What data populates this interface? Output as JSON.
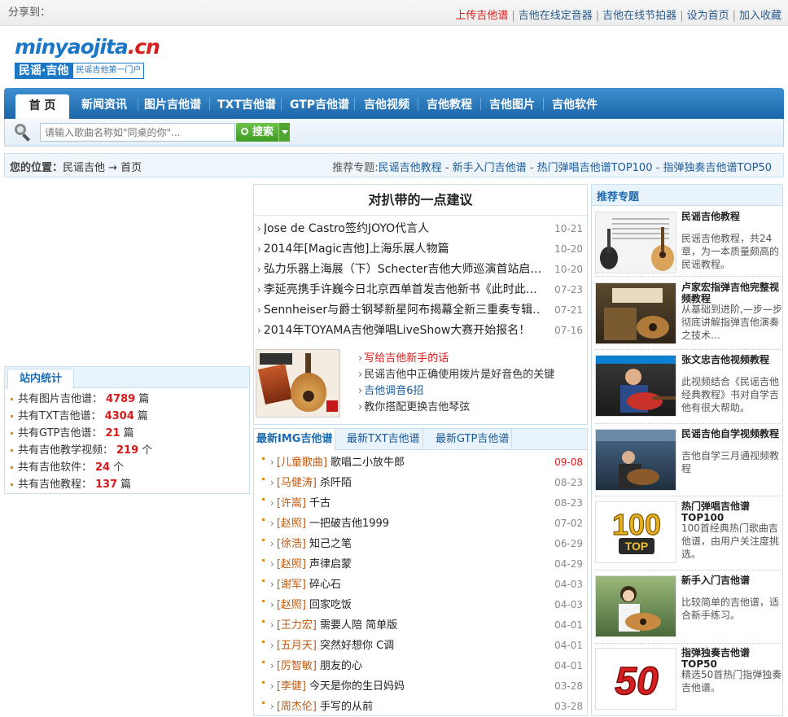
{
  "topbar": {
    "share_label": "分享到：",
    "links": [
      {
        "label": "上传吉他谱",
        "hot": true
      },
      {
        "label": "吉他在线定音器",
        "hot": false
      },
      {
        "label": "吉他在线节拍器",
        "hot": false
      },
      {
        "label": "设为首页",
        "hot": false
      },
      {
        "label": "加入收藏",
        "hot": false
      }
    ]
  },
  "logo": {
    "word_main": "minyaojita",
    "word_dot": ".cn",
    "cn_name": "民谣·吉他",
    "tagline": "民谣吉他第一门户"
  },
  "nav": {
    "items": [
      "首 页",
      "新闻资讯",
      "图片吉他谱",
      "TXT吉他谱",
      "GTP吉他谱",
      "吉他视频",
      "吉他教程",
      "吉他图片",
      "吉他软件"
    ]
  },
  "search": {
    "placeholder": "请输入歌曲名称如\"同桌的你\"...",
    "button_label": "搜索"
  },
  "breadcrumb": {
    "label": "您的位置：",
    "path": "民谣吉他 → 首页",
    "recommend_label": "推荐专题:",
    "recommend_links": [
      "民谣吉他教程",
      "新手入门吉他谱",
      "热门弹唱吉他谱TOP100",
      "指弹独奏吉他谱TOP50"
    ],
    "sep": " - "
  },
  "stats": {
    "title": "站内统计",
    "items": [
      {
        "prefix": "共有图片吉他谱：",
        "num": "4789",
        "unit": "篇"
      },
      {
        "prefix": "共有TXT吉他谱：",
        "num": "4304",
        "unit": "篇"
      },
      {
        "prefix": "共有GTP吉他谱：",
        "num": "21",
        "unit": "篇"
      },
      {
        "prefix": "共有吉他教学视频：",
        "num": "219",
        "unit": "个"
      },
      {
        "prefix": "共有吉他软件：",
        "num": "24",
        "unit": "个"
      },
      {
        "prefix": "共有吉他教程：",
        "num": "137",
        "unit": "篇"
      }
    ]
  },
  "news": {
    "title": "对扒带的一点建议",
    "items": [
      {
        "title": "Jose de Castro签约JOYO代言人",
        "date": "10-21"
      },
      {
        "title": "2014年[Magic吉他]上海乐展人物篇",
        "date": "10-20"
      },
      {
        "title": "弘力乐器上海展（下）Schecter吉他大师巡演首站启…",
        "date": "10-20"
      },
      {
        "title": "李延亮携手许巍今日北京西单首发吉他新书《此时此…",
        "date": "07-23"
      },
      {
        "title": "Sennheiser与爵士钢琴新星阿布揭幕全新三重奏专辑…",
        "date": "07-21"
      },
      {
        "title": "2014年TOYAMA吉他弹唱LiveShow大赛开始报名！",
        "date": "07-16"
      }
    ]
  },
  "promo": {
    "links": [
      {
        "label": "写给吉他新手的话",
        "style": "red"
      },
      {
        "label": "民谣吉他中正确使用拨片是好音色的关键",
        "style": "plain"
      },
      {
        "label": "吉他调音6招",
        "style": "blue"
      },
      {
        "label": "教你搭配更换吉他琴弦",
        "style": "plain"
      }
    ]
  },
  "tabs": {
    "labels": [
      "最新IMG吉他谱",
      "最新TXT吉他谱",
      "最新GTP吉他谱"
    ],
    "active": 0,
    "songs": [
      {
        "artist": "[儿童歌曲]",
        "title": "歌唱二小放牛郎",
        "date": "09-08",
        "hot": true
      },
      {
        "artist": "[马健涛]",
        "title": "杀阡陌",
        "date": "08-23",
        "hot": false
      },
      {
        "artist": "[许嵩]",
        "title": "千古",
        "date": "08-23",
        "hot": false
      },
      {
        "artist": "[赵照]",
        "title": "一把破吉他1999",
        "date": "07-02",
        "hot": false
      },
      {
        "artist": "[徐浩]",
        "title": "知己之笔",
        "date": "06-29",
        "hot": false
      },
      {
        "artist": "[赵照]",
        "title": "声律启蒙",
        "date": "04-29",
        "hot": false
      },
      {
        "artist": "[谢军]",
        "title": "碎心石",
        "date": "04-03",
        "hot": false
      },
      {
        "artist": "[赵照]",
        "title": "回家吃饭",
        "date": "04-03",
        "hot": false
      },
      {
        "artist": "[王力宏]",
        "title": "需要人陪 简单版",
        "date": "04-01",
        "hot": false
      },
      {
        "artist": "[五月天]",
        "title": "突然好想你 C调",
        "date": "04-01",
        "hot": false
      },
      {
        "artist": "[厉智敏]",
        "title": "朋友的心",
        "date": "04-01",
        "hot": false
      },
      {
        "artist": "[李健]",
        "title": "今天是你的生日妈妈",
        "date": "03-28",
        "hot": false
      },
      {
        "artist": "[周杰伦]",
        "title": "手写的从前",
        "date": "03-28",
        "hot": false
      }
    ]
  },
  "recommend": {
    "title": "推荐专题",
    "items": [
      {
        "title": "民谣吉他教程",
        "desc": "民谣吉他教程，共24章，为一本质量颇高的民谣教程。",
        "thumb": "guitar-tab-thumb"
      },
      {
        "title": "卢家宏指弹吉他完整视频教程",
        "desc": "从基础到进阶,—步—步彻底讲解指弹吉他演奏之技术…",
        "thumb": "video-thumb"
      },
      {
        "title": "张文忠吉他视频教程",
        "desc": "此视频结合《民谣吉他经典教程》书对自学吉他有很大帮助。",
        "thumb": "player-thumb"
      },
      {
        "title": "民谣吉他自学视频教程",
        "desc": "吉他自学三月通视频教程",
        "thumb": "self-study-thumb"
      },
      {
        "title": "热门弹唱吉他谱TOP100",
        "desc": "100首经典热门歌曲吉他谱，由用户关注度挑选。",
        "thumb": "top100-thumb"
      },
      {
        "title": "新手入门吉他谱",
        "desc": "比较简单的吉他谱，适合新手练习。",
        "thumb": "girl-guitar-thumb"
      },
      {
        "title": "指弹独奏吉他谱TOP50",
        "desc": "精选50首热门指弹独奏吉他谱。",
        "thumb": "top50-thumb"
      }
    ]
  },
  "colors": {
    "nav_blue": "#1b66a8",
    "link_blue": "#1a5a9a",
    "hot_red": "#d71a1a",
    "artist_orange": "#c05a10"
  }
}
